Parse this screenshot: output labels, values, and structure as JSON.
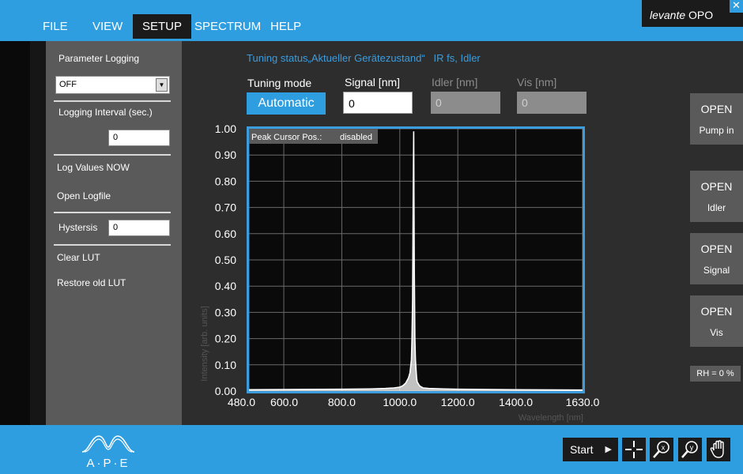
{
  "menu": {
    "file": "FILE",
    "view": "VIEW",
    "setup": "SETUP",
    "spectrum": "SPECTRUM",
    "help": "HELP"
  },
  "brand": {
    "italic": "levante",
    "normal": " OPO"
  },
  "close_label": "✕",
  "sidebar": {
    "parameter_logging": "Parameter Logging",
    "logging_select_value": "OFF",
    "logging_interval_label": "Logging Interval (sec.)",
    "logging_interval_value": "0",
    "log_values_now": "Log Values NOW",
    "open_logfile": "Open Logfile",
    "hysteresis_label": "Hystersis",
    "hysteresis_value": "0",
    "clear_lut": "Clear LUT",
    "restore_lut": "Restore old LUT"
  },
  "main": {
    "tuning_status": "Tuning status„Aktueller Gerätezustand“   IR fs, Idler",
    "tuning_mode_label": "Tuning mode",
    "tuning_mode_value": "Automatic",
    "signal_label": "Signal  [nm]",
    "signal_value": "0",
    "idler_label": "Idler [nm]",
    "idler_value": "0",
    "vis_label": "Vis [nm]",
    "vis_value": "0"
  },
  "chart_data": {
    "type": "line",
    "title": "",
    "xlabel": "Wavelength [nm]",
    "ylabel": "Intensity [arb. units]",
    "xlim": [
      480,
      1630
    ],
    "ylim": [
      0,
      1
    ],
    "x_ticks": [
      "480.0",
      "600.0",
      "800.0",
      "1000.0",
      "1200.0",
      "1400.0",
      "1630.0"
    ],
    "x_tick_values": [
      480,
      600,
      800,
      1000,
      1200,
      1400,
      1630
    ],
    "y_ticks": [
      "1.00",
      "0.90",
      "0.80",
      "0.70",
      "0.60",
      "0.50",
      "0.40",
      "0.30",
      "0.20",
      "0.10",
      "0.00"
    ],
    "y_tick_values": [
      1.0,
      0.9,
      0.8,
      0.7,
      0.6,
      0.5,
      0.4,
      0.3,
      0.2,
      0.1,
      0.0
    ],
    "grid": true,
    "overlay_label": "Peak Cursor Pos.:",
    "overlay_value": "disabled",
    "series": [
      {
        "x": [
          480,
          600,
          800,
          900,
          950,
          980,
          1000,
          1010,
          1020,
          1030,
          1035,
          1040,
          1042,
          1044,
          1046,
          1048,
          1050,
          1052,
          1054,
          1056,
          1058,
          1060,
          1065,
          1070,
          1080,
          1100,
          1150,
          1200,
          1400,
          1630
        ],
        "y": [
          0.005,
          0.006,
          0.007,
          0.008,
          0.01,
          0.012,
          0.015,
          0.02,
          0.03,
          0.05,
          0.07,
          0.12,
          0.2,
          0.35,
          0.72,
          0.99,
          0.45,
          0.2,
          0.12,
          0.08,
          0.05,
          0.035,
          0.025,
          0.018,
          0.012,
          0.01,
          0.008,
          0.007,
          0.005,
          0.004
        ]
      }
    ]
  },
  "right_panel": {
    "pump_top": "OPEN",
    "pump_bottom": "Pump in",
    "idler_top": "OPEN",
    "idler_bottom": "Idler",
    "signal_top": "OPEN",
    "signal_bottom": "Signal",
    "vis_top": "OPEN",
    "vis_bottom": "Vis",
    "rh": "RH = 0 %"
  },
  "bottom": {
    "logo_text": "A·P·E",
    "start_label": "Start",
    "play_icon": "▶"
  },
  "colors": {
    "accent": "#2f9ee0",
    "background": "#2d2d2d",
    "sidebar": "#5a5a5a",
    "chart_border": "#3c9cdc"
  }
}
